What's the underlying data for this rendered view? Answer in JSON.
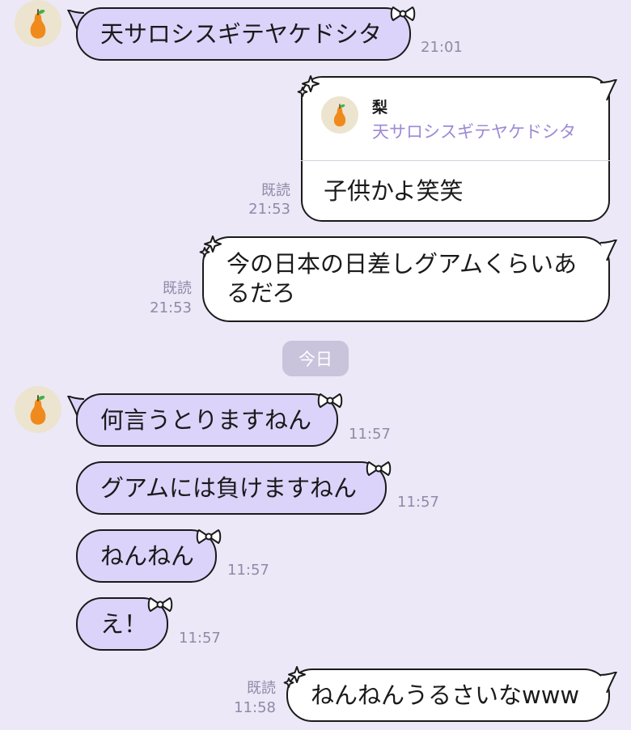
{
  "contact": {
    "name": "梨"
  },
  "messages": {
    "m1": {
      "text": "天サロシスギテヤケドシタ",
      "time": "21:01"
    },
    "m2": {
      "reply_name": "梨",
      "reply_text": "天サロシスギテヤケドシタ",
      "text": "子供かよ笑笑",
      "read": "既読",
      "time": "21:53"
    },
    "m3": {
      "line1": "今の日本の日差しグアムくらいあ",
      "line2": "るだろ",
      "read": "既読",
      "time": "21:53"
    },
    "m4": {
      "text": "何言うとりますねん",
      "time": "11:57"
    },
    "m5": {
      "text": "グアムには負けますねん",
      "time": "11:57"
    },
    "m6": {
      "text": "ねんねん",
      "time": "11:57"
    },
    "m7": {
      "text": "え！",
      "time": "11:57"
    },
    "m8": {
      "text": "ねんねんうるさいなwww",
      "read": "既読",
      "time": "11:58"
    }
  },
  "day_separator": "今日",
  "colors": {
    "background": "#ece8f7",
    "incoming_bubble": "#dcd3fb",
    "outgoing_bubble": "#ffffff",
    "reply_preview_text": "#9d8ad6",
    "meta_text": "#8f8aa8"
  },
  "icons": {
    "avatar": "pear-icon",
    "incoming_deco": "ribbon-bow-icon",
    "outgoing_deco": "sparkle-icon"
  }
}
